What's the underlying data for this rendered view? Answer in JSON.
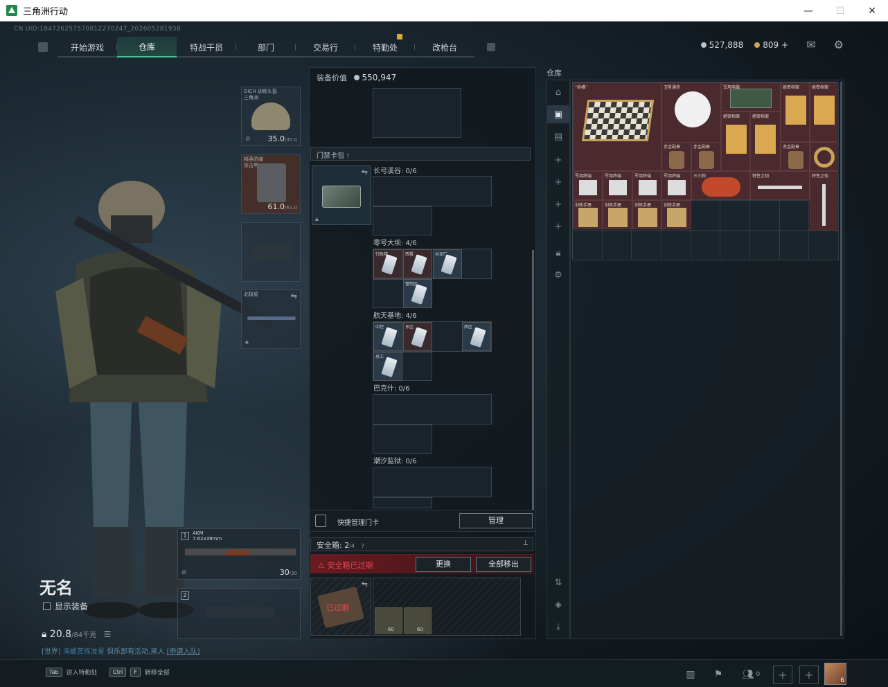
{
  "window": {
    "title": "三角洲行动",
    "minimize": "—",
    "maximize": "☐",
    "close": "✕"
  },
  "uid": "CN UID:18472625757081227024​7_202605281938",
  "nav": {
    "tabs": [
      {
        "label": "开始游戏"
      },
      {
        "label": "仓库"
      },
      {
        "label": "特战干员"
      },
      {
        "label": "部门"
      },
      {
        "label": "交易行"
      },
      {
        "label": "特勤处"
      },
      {
        "label": "改枪台"
      }
    ],
    "active_index": 1
  },
  "currency": {
    "silver": "527,888",
    "gold": "809",
    "plus": "+"
  },
  "equipment": {
    "helmet": {
      "label_line1": "DICH 训练头盔",
      "label_line2": "三角洲",
      "durability": "35.0",
      "durability_max": "/35.0"
    },
    "armor": {
      "label_line1": "精英防弹",
      "label_line2": "突击甲",
      "durability": "61.0",
      "durability_max": "/61.0"
    },
    "melee": {
      "label": "北极星"
    },
    "primary": {
      "num": "1",
      "name": "AKM",
      "caliber": "7.62x39mm",
      "ammo": "30",
      "ammo_max": "/30"
    },
    "secondary": {
      "num": "2"
    }
  },
  "player": {
    "name": "无名",
    "show_equipment": "显示装备",
    "weight": "20.8",
    "weight_max": "/84千克",
    "chat_channel": "[世界]",
    "chat_sender": "海螺苦练准星",
    "chat_text": "俱乐部有活动,来人",
    "chat_link": "[申请入队]"
  },
  "mid": {
    "value_label": "装备价值",
    "value": "550,947",
    "keycard_section": "门禁卡包",
    "help": "?",
    "zones": [
      {
        "name": "长弓溪谷: 0/6"
      },
      {
        "name": "零号大坝: 4/6"
      },
      {
        "name": "航天基地: 4/6"
      },
      {
        "name": "巴克什: 0/6"
      },
      {
        "name": "潮汐监狱: 0/6"
      }
    ],
    "dam_cards": [
      "行政楼",
      "西楼",
      "水泥厂",
      "管制区"
    ],
    "base_cards": [
      "中控",
      "东区",
      "西区",
      "总工"
    ],
    "quick_manage": "快捷管理门卡",
    "manage_btn": "管理",
    "safe_label": "安全箱:",
    "safe_count": "2",
    "safe_max": "/4",
    "safe_expired_warning": "安全箱已过期",
    "replace_btn": "更换",
    "move_all_btn": "全部移出",
    "expired_tag": "已过期",
    "safe_item_1": "60",
    "safe_item_2": "60"
  },
  "warehouse": {
    "title": "仓库",
    "items": [
      {
        "label": "“纵横”"
      },
      {
        "label": "卫星通信"
      },
      {
        "label": "军用电脑"
      },
      {
        "label": "绝密档案"
      },
      {
        "label": "绝密档案"
      },
      {
        "label": "绝密档案"
      },
      {
        "label": "绝密档案"
      },
      {
        "label": "赤金勋章"
      },
      {
        "label": "赤金勋章"
      },
      {
        "label": "赤金勋章"
      },
      {
        "label": "军用终端"
      },
      {
        "label": "军用终端"
      },
      {
        "label": "军用终端"
      },
      {
        "label": "军用终端"
      },
      {
        "label": "三小狗"
      },
      {
        "label": "特性之钥"
      },
      {
        "label": "特性之钥"
      },
      {
        "label": "训练手册"
      },
      {
        "label": "训练手册"
      },
      {
        "label": "训练手册"
      },
      {
        "label": "训练手册"
      }
    ]
  },
  "bottom": {
    "hint1_key": "Tab",
    "hint1_text": "进入特勤处",
    "hint2_key1": "Ctrl",
    "hint2_key2": "F",
    "hint2_text": "转移全部",
    "friends_count": "0",
    "avatar_level": "6"
  },
  "colors": {
    "accent_green": "#46c08e",
    "warning_red": "#e04a4e",
    "badge_yellow": "#e0a72a"
  }
}
